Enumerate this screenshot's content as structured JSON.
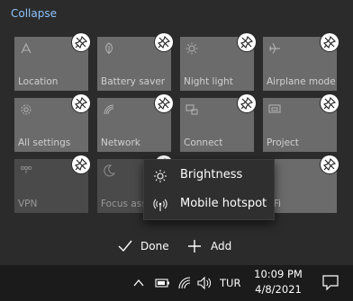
{
  "header": {
    "collapse_label": "Collapse"
  },
  "tiles": [
    {
      "label": "Location",
      "icon": "location-icon"
    },
    {
      "label": "Battery saver",
      "icon": "leaf-icon"
    },
    {
      "label": "Night light",
      "icon": "sun-icon"
    },
    {
      "label": "Airplane mode",
      "icon": "airplane-icon"
    },
    {
      "label": "All settings",
      "icon": "gear-icon"
    },
    {
      "label": "Network",
      "icon": "network-icon"
    },
    {
      "label": "Connect",
      "icon": "connect-icon"
    },
    {
      "label": "Project",
      "icon": "project-icon"
    },
    {
      "label": "VPN",
      "icon": "vpn-icon"
    },
    {
      "label": "Focus assi",
      "icon": "moon-icon"
    },
    {
      "label": "-Fi",
      "icon": "wifi-icon"
    }
  ],
  "add_menu": {
    "items": [
      {
        "label": "Brightness",
        "icon": "brightness-icon"
      },
      {
        "label": "Mobile hotspot",
        "icon": "hotspot-icon"
      }
    ]
  },
  "footer": {
    "done_label": "Done",
    "add_label": "Add"
  },
  "taskbar": {
    "language": "TUR",
    "time": "10:09 PM",
    "date": "4/8/2021"
  },
  "colors": {
    "accent": "#8cc4ff",
    "tile_active": "#6b6b6b",
    "tile_dim": "#4a4a4a",
    "background": "#2b2b2b",
    "taskbar": "#1b1b1b"
  }
}
